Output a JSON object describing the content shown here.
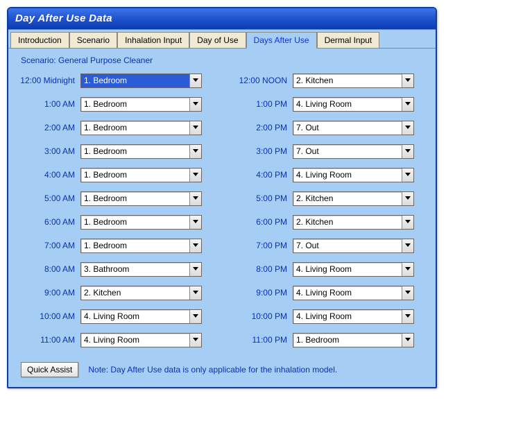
{
  "window": {
    "title": "Day After Use Data"
  },
  "tabs": [
    {
      "label": "Introduction",
      "active": false
    },
    {
      "label": "Scenario",
      "active": false
    },
    {
      "label": "Inhalation Input",
      "active": false
    },
    {
      "label": "Day of Use",
      "active": false
    },
    {
      "label": "Days After Use",
      "active": true
    },
    {
      "label": "Dermal Input",
      "active": false
    }
  ],
  "scenario_prefix": "Scenario: ",
  "scenario_name": "General Purpose Cleaner",
  "left": [
    {
      "time": "12:00 Midnight",
      "value": "1. Bedroom",
      "highlight": true
    },
    {
      "time": "1:00 AM",
      "value": "1. Bedroom"
    },
    {
      "time": "2:00 AM",
      "value": "1. Bedroom"
    },
    {
      "time": "3:00 AM",
      "value": "1. Bedroom"
    },
    {
      "time": "4:00 AM",
      "value": "1. Bedroom"
    },
    {
      "time": "5:00 AM",
      "value": "1. Bedroom"
    },
    {
      "time": "6:00 AM",
      "value": "1. Bedroom"
    },
    {
      "time": "7:00 AM",
      "value": "1. Bedroom"
    },
    {
      "time": "8:00 AM",
      "value": "3. Bathroom"
    },
    {
      "time": "9:00 AM",
      "value": "2. Kitchen"
    },
    {
      "time": "10:00 AM",
      "value": "4. Living Room"
    },
    {
      "time": "11:00 AM",
      "value": "4. Living Room"
    }
  ],
  "right": [
    {
      "time": "12:00 NOON",
      "value": "2. Kitchen"
    },
    {
      "time": "1:00 PM",
      "value": "4. Living Room"
    },
    {
      "time": "2:00 PM",
      "value": "7. Out"
    },
    {
      "time": "3:00 PM",
      "value": "7. Out"
    },
    {
      "time": "4:00 PM",
      "value": "4. Living Room"
    },
    {
      "time": "5:00 PM",
      "value": "2. Kitchen"
    },
    {
      "time": "6:00 PM",
      "value": "2. Kitchen"
    },
    {
      "time": "7:00 PM",
      "value": "7. Out"
    },
    {
      "time": "8:00 PM",
      "value": "4. Living Room"
    },
    {
      "time": "9:00 PM",
      "value": "4. Living Room"
    },
    {
      "time": "10:00 PM",
      "value": "4. Living Room"
    },
    {
      "time": "11:00 PM",
      "value": "1. Bedroom"
    }
  ],
  "footer": {
    "button": "Quick Assist",
    "note": "Note: Day After Use data is only applicable for the inhalation model."
  }
}
